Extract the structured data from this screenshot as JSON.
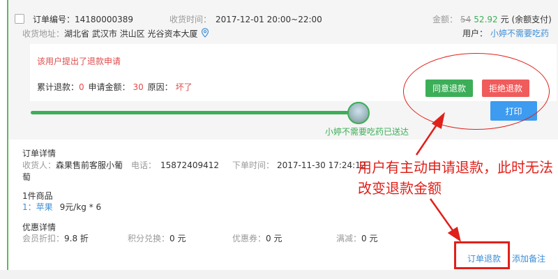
{
  "order": {
    "number_label": "订单编号：",
    "number": "14180000389",
    "delivery_time_label": "收货时间：",
    "delivery_time": "2017-12-01 20:00~22:00",
    "amount_label": "金额：",
    "amount_original": "54",
    "amount_current": "52.92",
    "amount_note": "元 (余额支付)",
    "address_label": "收货地址：",
    "address": "湖北省 武汉市 洪山区 光谷资本大厦",
    "user_label": "用户：",
    "user_name": "小婷不需要吃药"
  },
  "refund": {
    "notice": "该用户提出了退款申请",
    "total_label": "累计退款：",
    "total_value": "0",
    "apply_amount_label": "申请金额：",
    "apply_amount_value": "30",
    "reason_label": "原因：",
    "reason_value": "坏了",
    "agree_button": "同意退款",
    "reject_button": "拒绝退款",
    "print_button": "打印"
  },
  "progress": {
    "status_text": "小婷不需要吃药已送达",
    "fraction": 1.0
  },
  "details": {
    "title": "订单详情",
    "receiver_label": "收货人：",
    "receiver_line1": "森果售前客服小葡",
    "receiver_line2": "萄",
    "phone_label": "电话：",
    "phone": "15872409412",
    "order_time_label": "下单时间：",
    "order_time": "2017-11-30 17:24:12",
    "goods_title": "1件商品",
    "goods_index": "1：",
    "goods_name": "苹果",
    "goods_spec": "9元/kg * 6",
    "discount_title": "优惠详情",
    "member_discount_label": "会员折扣：",
    "member_discount_value": "9.8 折",
    "points_label": "积分兑换：",
    "points_value": "0 元",
    "coupon_label": "优惠券：",
    "coupon_value": "0 元",
    "fullcut_label": "满减：",
    "fullcut_value": "0 元"
  },
  "actions": {
    "order_refund": "订单退款",
    "add_note": "添加备注"
  },
  "annotation": {
    "text": "用户有主动申请退款，此时无法改变退款金额"
  },
  "colors": {
    "green": "#3cae58",
    "red": "#f05b5b",
    "blue": "#3d9bf0",
    "annotation_red": "#e0201a"
  }
}
